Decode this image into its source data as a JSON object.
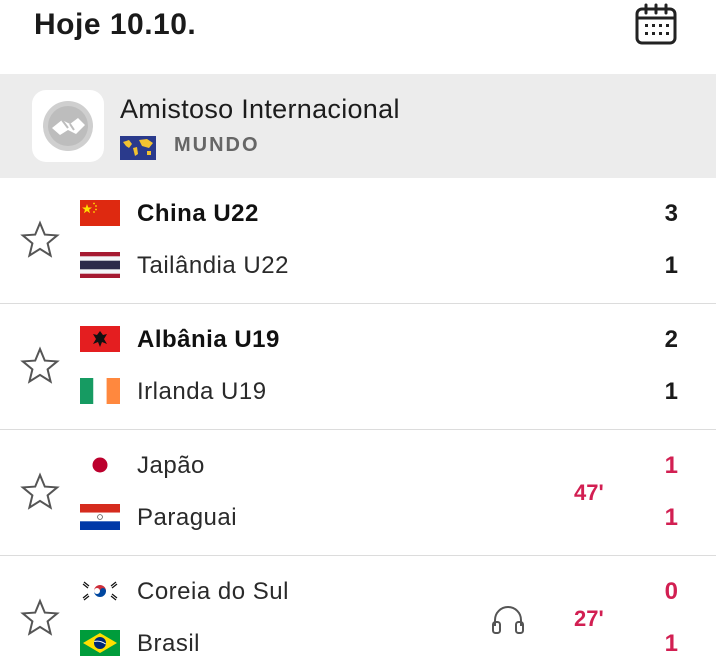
{
  "header": {
    "title": "Hoje 10.10.",
    "calendar_icon": "calendar-icon"
  },
  "league": {
    "name": "Amistoso Internacional",
    "country": "MUNDO",
    "logo_icon": "handshake-icon",
    "flag_icon": "world-flag-icon"
  },
  "matches": [
    {
      "home": {
        "name": "China U22",
        "flag": "china-flag",
        "score": "3",
        "winner": true
      },
      "away": {
        "name": "Tailândia U22",
        "flag": "thailand-flag",
        "score": "1",
        "winner": false
      },
      "live": false
    },
    {
      "home": {
        "name": "Albânia U19",
        "flag": "albania-flag",
        "score": "2",
        "winner": true
      },
      "away": {
        "name": "Irlanda U19",
        "flag": "ireland-flag",
        "score": "1",
        "winner": false
      },
      "live": false
    },
    {
      "home": {
        "name": "Japão",
        "flag": "japan-flag",
        "score": "1",
        "winner": false
      },
      "away": {
        "name": "Paraguai",
        "flag": "paraguay-flag",
        "score": "1",
        "winner": false
      },
      "live": true,
      "minute": "47'"
    },
    {
      "home": {
        "name": "Coreia do Sul",
        "flag": "south-korea-flag",
        "score": "0",
        "winner": false
      },
      "away": {
        "name": "Brasil",
        "flag": "brazil-flag",
        "score": "1",
        "winner": false
      },
      "live": true,
      "minute": "27'",
      "audio_icon": "headphones-icon"
    }
  ],
  "colors": {
    "live": "#d21f52",
    "league_bg": "#ececec",
    "divider": "#dcdcdc"
  }
}
